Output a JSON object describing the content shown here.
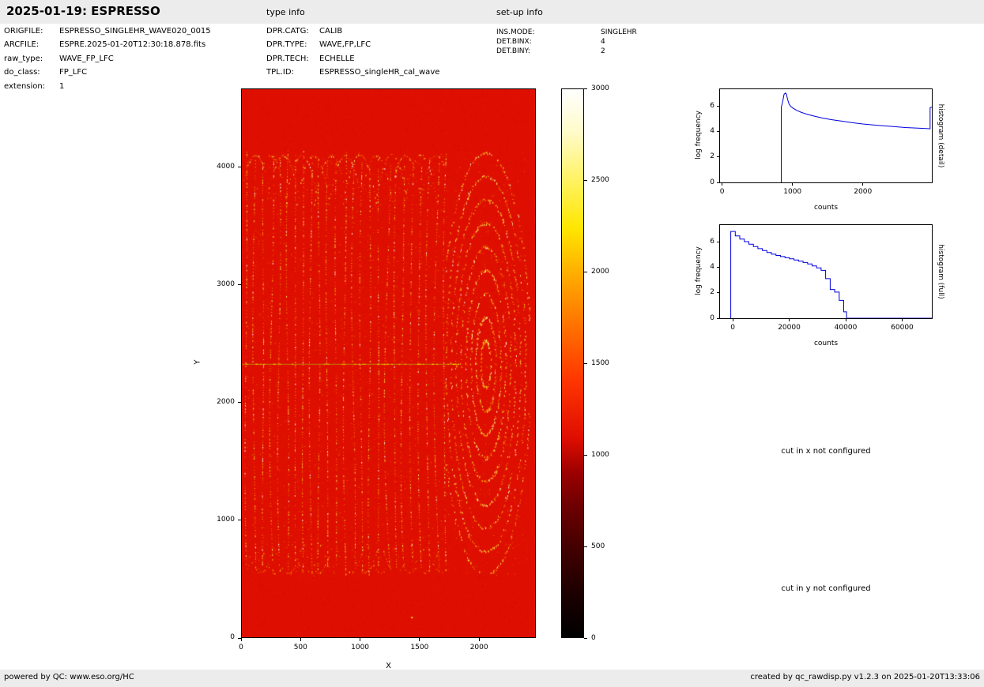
{
  "header": {
    "title": "2025-01-19: ESPRESSO",
    "type_info_label": "type info",
    "setup_info_label": "set-up info"
  },
  "file_info": {
    "rows": [
      {
        "label": "ORIGFILE:",
        "value": "ESPRESSO_SINGLEHR_WAVE020_0015"
      },
      {
        "label": "ARCFILE:",
        "value": "ESPRE.2025-01-20T12:30:18.878.fits"
      },
      {
        "label": "raw_type:",
        "value": "WAVE_FP_LFC"
      },
      {
        "label": "do_class:",
        "value": "FP_LFC"
      },
      {
        "label": "extension:",
        "value": "1"
      }
    ]
  },
  "type_info": {
    "rows": [
      {
        "label": "DPR.CATG:",
        "value": "CALIB"
      },
      {
        "label": "DPR.TYPE:",
        "value": "WAVE,FP,LFC"
      },
      {
        "label": "DPR.TECH:",
        "value": "ECHELLE"
      },
      {
        "label": "TPL.ID:",
        "value": "ESPRESSO_singleHR_cal_wave"
      }
    ]
  },
  "setup_info": {
    "rows": [
      {
        "label": "INS.MODE:",
        "value": "SINGLEHR"
      },
      {
        "label": "DET.BINX:",
        "value": "4"
      },
      {
        "label": "DET.BINY:",
        "value": "2"
      }
    ]
  },
  "notes": {
    "cut_x": "cut in x not configured",
    "cut_y": "cut in y not configured"
  },
  "footer": {
    "left": "powered by QC: www.eso.org/HC",
    "right": "created by qc_rawdisp.py v1.2.3 on 2025-01-20T13:33:06"
  },
  "chart_data": [
    {
      "type": "heatmap",
      "xlabel": "X",
      "ylabel": "Y",
      "xlim": [
        0,
        2477
      ],
      "ylim": [
        0,
        4671
      ],
      "xticks": [
        0,
        500,
        1000,
        1500,
        2000
      ],
      "yticks": [
        0,
        1000,
        2000,
        3000,
        4000
      ],
      "colormap": "hot",
      "background_counts": 1000,
      "colorbar": {
        "min": 0,
        "max": 3000,
        "ticks": [
          0,
          500,
          1000,
          1500,
          2000,
          2500,
          3000
        ]
      },
      "features": {
        "line_columns": {
          "x_start": 28,
          "x_end": 1710,
          "spacing": 66,
          "y_bottom": 540,
          "y_top": 4100
        },
        "ring_pattern": {
          "center_x": 2060,
          "center_y": 2330,
          "n_rings": 9
        },
        "horizontal_line_y": 2330,
        "horizontal_line_x_end": 1830
      }
    },
    {
      "type": "line",
      "name": "histogram (detail)",
      "xlabel": "counts",
      "ylabel": "log frequency",
      "right_label": "histogram (detail)",
      "xlim": [
        -30,
        2980
      ],
      "ylim": [
        0,
        7.3
      ],
      "xticks": [
        0,
        1000,
        2000
      ],
      "yticks": [
        0,
        2,
        4,
        6
      ],
      "color": "#0000dd",
      "step": false,
      "points": [
        [
          840,
          0
        ],
        [
          840,
          5.9
        ],
        [
          860,
          6.3
        ],
        [
          880,
          6.9
        ],
        [
          900,
          7.0
        ],
        [
          915,
          6.9
        ],
        [
          930,
          6.5
        ],
        [
          950,
          6.15
        ],
        [
          975,
          5.95
        ],
        [
          1010,
          5.8
        ],
        [
          1060,
          5.65
        ],
        [
          1120,
          5.5
        ],
        [
          1200,
          5.35
        ],
        [
          1300,
          5.2
        ],
        [
          1420,
          5.05
        ],
        [
          1550,
          4.92
        ],
        [
          1700,
          4.8
        ],
        [
          1850,
          4.68
        ],
        [
          2000,
          4.58
        ],
        [
          2150,
          4.5
        ],
        [
          2300,
          4.43
        ],
        [
          2450,
          4.37
        ],
        [
          2600,
          4.3
        ],
        [
          2750,
          4.26
        ],
        [
          2900,
          4.22
        ],
        [
          2955,
          4.2
        ],
        [
          2955,
          5.85
        ],
        [
          2980,
          5.9
        ]
      ]
    },
    {
      "type": "line",
      "name": "histogram (full)",
      "xlabel": "counts",
      "ylabel": "log frequency",
      "right_label": "histogram (full)",
      "xlim": [
        -4500,
        70500
      ],
      "ylim": [
        0,
        7.3
      ],
      "xticks": [
        0,
        20000,
        40000,
        60000
      ],
      "yticks": [
        0,
        2,
        4,
        6
      ],
      "color": "#0000dd",
      "step": true,
      "points": [
        [
          -700,
          0
        ],
        [
          -700,
          6.8
        ],
        [
          900,
          6.45
        ],
        [
          2500,
          6.2
        ],
        [
          4100,
          6.0
        ],
        [
          5700,
          5.8
        ],
        [
          7300,
          5.62
        ],
        [
          8900,
          5.45
        ],
        [
          10500,
          5.3
        ],
        [
          12100,
          5.15
        ],
        [
          13700,
          5.02
        ],
        [
          15300,
          4.92
        ],
        [
          16900,
          4.83
        ],
        [
          18500,
          4.74
        ],
        [
          20100,
          4.65
        ],
        [
          21700,
          4.56
        ],
        [
          23300,
          4.47
        ],
        [
          24900,
          4.37
        ],
        [
          26500,
          4.25
        ],
        [
          28100,
          4.1
        ],
        [
          29700,
          3.95
        ],
        [
          31300,
          3.75
        ],
        [
          32900,
          3.1
        ],
        [
          34500,
          2.25
        ],
        [
          36100,
          2.05
        ],
        [
          37700,
          1.4
        ],
        [
          39300,
          0.5
        ],
        [
          40300,
          0
        ],
        [
          70500,
          0
        ]
      ]
    }
  ]
}
